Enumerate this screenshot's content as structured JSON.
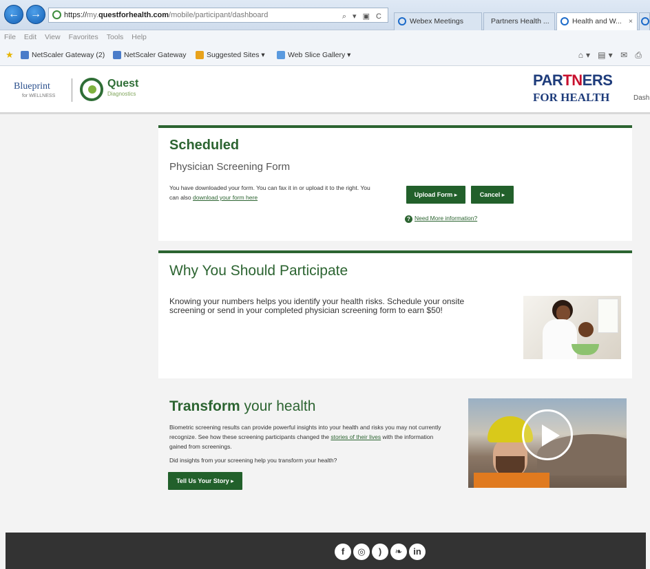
{
  "browser": {
    "address": {
      "protocol": "https://",
      "subdomain": "my.",
      "host": "questforhealth.com",
      "path": "/mobile/participant/dashboard",
      "tools": "⌕ ▾ ▣ C"
    },
    "tabs": [
      {
        "label": "Webex Meetings"
      },
      {
        "label": "Partners Health ..."
      },
      {
        "label": "Health and W..."
      }
    ],
    "menu": [
      "File",
      "Edit",
      "View",
      "Favorites",
      "Tools",
      "Help"
    ],
    "favorites": [
      {
        "label": "NetScaler Gateway (2)"
      },
      {
        "label": "NetScaler Gateway"
      },
      {
        "label": "Suggested Sites ▾"
      },
      {
        "label": "Web Slice Gallery ▾"
      }
    ]
  },
  "header": {
    "blueprint": "Blueprint",
    "blueprint_sub": "for WELLNESS",
    "quest": "Quest",
    "quest_sub": "Diagnostics",
    "partners_pre": "PAR",
    "partners_tn": "TN",
    "partners_post": "ERS",
    "for_health": "FOR HEALTH",
    "dash_link": "Dash"
  },
  "scheduled": {
    "title": "Scheduled",
    "subtitle": "Physician Screening Form",
    "text": "You have downloaded your form. You can fax it in or upload it to the right. You can also",
    "download_link": "download your form here",
    "upload_button": "Upload Form ▸",
    "cancel_button": "Cancel ▸",
    "help_link": "Need More information?"
  },
  "why": {
    "title": "Why You Should Participate",
    "text": "Knowing your numbers helps you identify your health risks. Schedule your onsite screening or send in your completed physician screening form to earn $50!"
  },
  "transform": {
    "title_bold": "Transform",
    "title_rest": " your health",
    "text": "Biometric screening results can provide powerful insights into your health and risks you may not currently recognize. See how these screening participants changed the",
    "stories_link": "stories of their lives",
    "text_end": "with the information gained from screenings.",
    "question": "Did insights from your screening help you transform your health?",
    "story_button": "Tell Us Your Story ▸"
  },
  "footer": {
    "social": [
      {
        "name": "facebook-icon",
        "glyph": "f"
      },
      {
        "name": "instagram-icon",
        "glyph": "◎"
      },
      {
        "name": "rss-icon",
        "glyph": ")"
      },
      {
        "name": "twitter-icon",
        "glyph": "❧"
      },
      {
        "name": "linkedin-icon",
        "glyph": "in"
      }
    ]
  },
  "colors": {
    "brand_green": "#2c6431",
    "button_green": "#22602b",
    "partners_blue": "#1e3c7b",
    "partners_red": "#c8102e",
    "footer": "#333333"
  }
}
